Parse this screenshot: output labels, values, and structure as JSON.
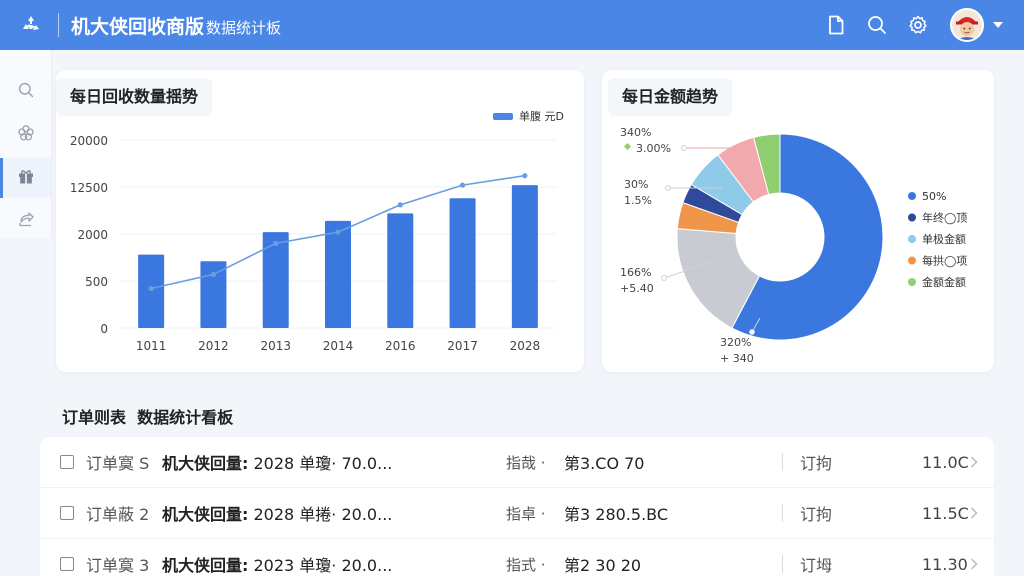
{
  "header": {
    "title_main": "机大侠回收商版",
    "title_sub": "数据统计板",
    "bg_color": "#4a86e6",
    "icons": [
      "recycle-logo-icon",
      "document-icon",
      "search-icon",
      "gear-icon",
      "avatar",
      "chevron-down-icon"
    ]
  },
  "sidebar": {
    "items": [
      {
        "icon": "search-icon",
        "active": false
      },
      {
        "icon": "flower-icon",
        "active": false
      },
      {
        "icon": "gift-icon",
        "active": true
      },
      {
        "icon": "share-icon",
        "active": false
      }
    ]
  },
  "bar_card": {
    "title": "每日回收数量揺势",
    "legend": "单腹 元D"
  },
  "pie_card": {
    "title": "每日金额趋势",
    "legend": [
      {
        "label": "50%",
        "color": "#3a78e0"
      },
      {
        "label": "年终◯顶",
        "color": "#2f4a9a"
      },
      {
        "label": "单极金额",
        "color": "#8fcbe8"
      },
      {
        "label": "每拱◯项",
        "color": "#f0964a"
      },
      {
        "label": "金额金额",
        "color": "#8fcf72"
      }
    ],
    "callouts": [
      {
        "line1": "340%",
        "line2": "3.00%"
      },
      {
        "line1": "30%",
        "line2": "1.5%"
      },
      {
        "line1": "166%",
        "line2": "+5.40"
      },
      {
        "line1": "320%",
        "line2": "+ 340"
      }
    ]
  },
  "chart_data": [
    {
      "type": "bar",
      "title": "每日回收数量揺势",
      "categories": [
        "1011",
        "2012",
        "2013",
        "2014",
        "2016",
        "2017",
        "2028"
      ],
      "y_ticks": [
        "20000",
        "12500",
        "2000",
        "500",
        "0"
      ],
      "series": [
        {
          "name": "单腹 元D",
          "type": "bar",
          "color": "#3a78e0",
          "values": [
            7800,
            7100,
            10200,
            11400,
            12200,
            13800,
            15200
          ]
        },
        {
          "type": "line",
          "color": "#6a9de0",
          "values": [
            4200,
            5700,
            9000,
            10200,
            13100,
            15200,
            16200
          ]
        }
      ],
      "ylim": [
        0,
        20000
      ],
      "grid": true,
      "legend": "top-right"
    },
    {
      "type": "pie",
      "title": "每日金额趋势",
      "donut": true,
      "slices": [
        {
          "label": "50%",
          "value": 56,
          "color": "#3a78e0"
        },
        {
          "label": "",
          "value": 18,
          "color": "#c8ccd2"
        },
        {
          "label": "每拱◯项",
          "value": 4,
          "color": "#f0964a"
        },
        {
          "label": "年终◯顶",
          "value": 3,
          "color": "#2f4a9a"
        },
        {
          "label": "单极金额",
          "value": 6,
          "color": "#8fcbe8"
        },
        {
          "label": "",
          "value": 6,
          "color": "#f2a9ae"
        },
        {
          "label": "金额金额",
          "value": 4,
          "color": "#8fcf72"
        }
      ]
    }
  ],
  "orders": {
    "title": "订单则表  数据统计看板",
    "rows": [
      {
        "id": "订单寞 S",
        "name": "机大侠回量:",
        "name_rest": "2028 单瓊· 70.0...",
        "tag": "指哉 ·",
        "value": "第3.CO 70",
        "status": "订拘",
        "amount": "11.0C"
      },
      {
        "id": "订单蔽 2",
        "name": "机大侠回量:",
        "name_rest": "2028 单捲· 20.0...",
        "tag": "指卓 ·",
        "value": "第3  280.5.BC",
        "status": "订拘",
        "amount": "11.5C"
      },
      {
        "id": "订单寞 3",
        "name": "机大侠回量:",
        "name_rest": "2023 单瓊· 20.0...",
        "tag": "指式 ·",
        "value": "第2  30 20",
        "status": "订坶",
        "amount": "11.30"
      }
    ]
  }
}
